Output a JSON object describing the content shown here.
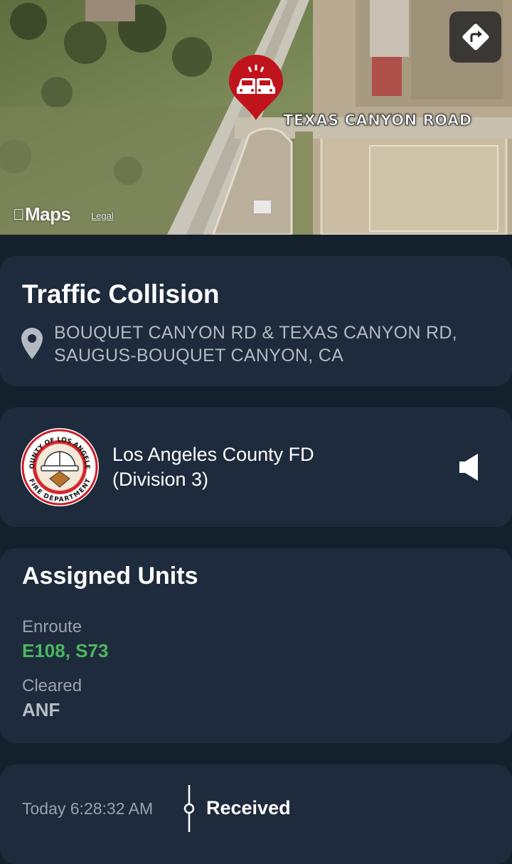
{
  "map": {
    "road_label": "TEXAS CANYON ROAD",
    "provider_label": "Maps",
    "legal_label": "Legal",
    "pin_icon": "traffic-collision-icon",
    "pin_color": "#c0141c",
    "directions_icon": "directions-icon"
  },
  "incident": {
    "title": "Traffic Collision",
    "address_line1": "BOUQUET CANYON RD & TEXAS CANYON RD,",
    "address_line2": "SAUGUS-BOUQUET CANYON, CA",
    "location_icon": "location-pin-icon"
  },
  "agency": {
    "name_line1": "Los Angeles County FD",
    "name_line2": "(Division 3)",
    "logo_text_top": "COUNTY OF LOS ANGELES",
    "logo_text_bottom": "FIRE DEPARTMENT",
    "audio_icon": "speaker-icon"
  },
  "units": {
    "title": "Assigned Units",
    "groups": [
      {
        "label": "Enroute",
        "value": "E108, S73",
        "color": "#4cb860"
      },
      {
        "label": "Cleared",
        "value": "ANF",
        "color": "#b7bcc4"
      }
    ]
  },
  "timeline": {
    "entries": [
      {
        "time": "Today 6:28:32 AM",
        "status": "Received"
      }
    ]
  },
  "theme": {
    "background": "#15202d",
    "card": "#1e2b3c",
    "text_secondary": "#9aa2ad"
  }
}
